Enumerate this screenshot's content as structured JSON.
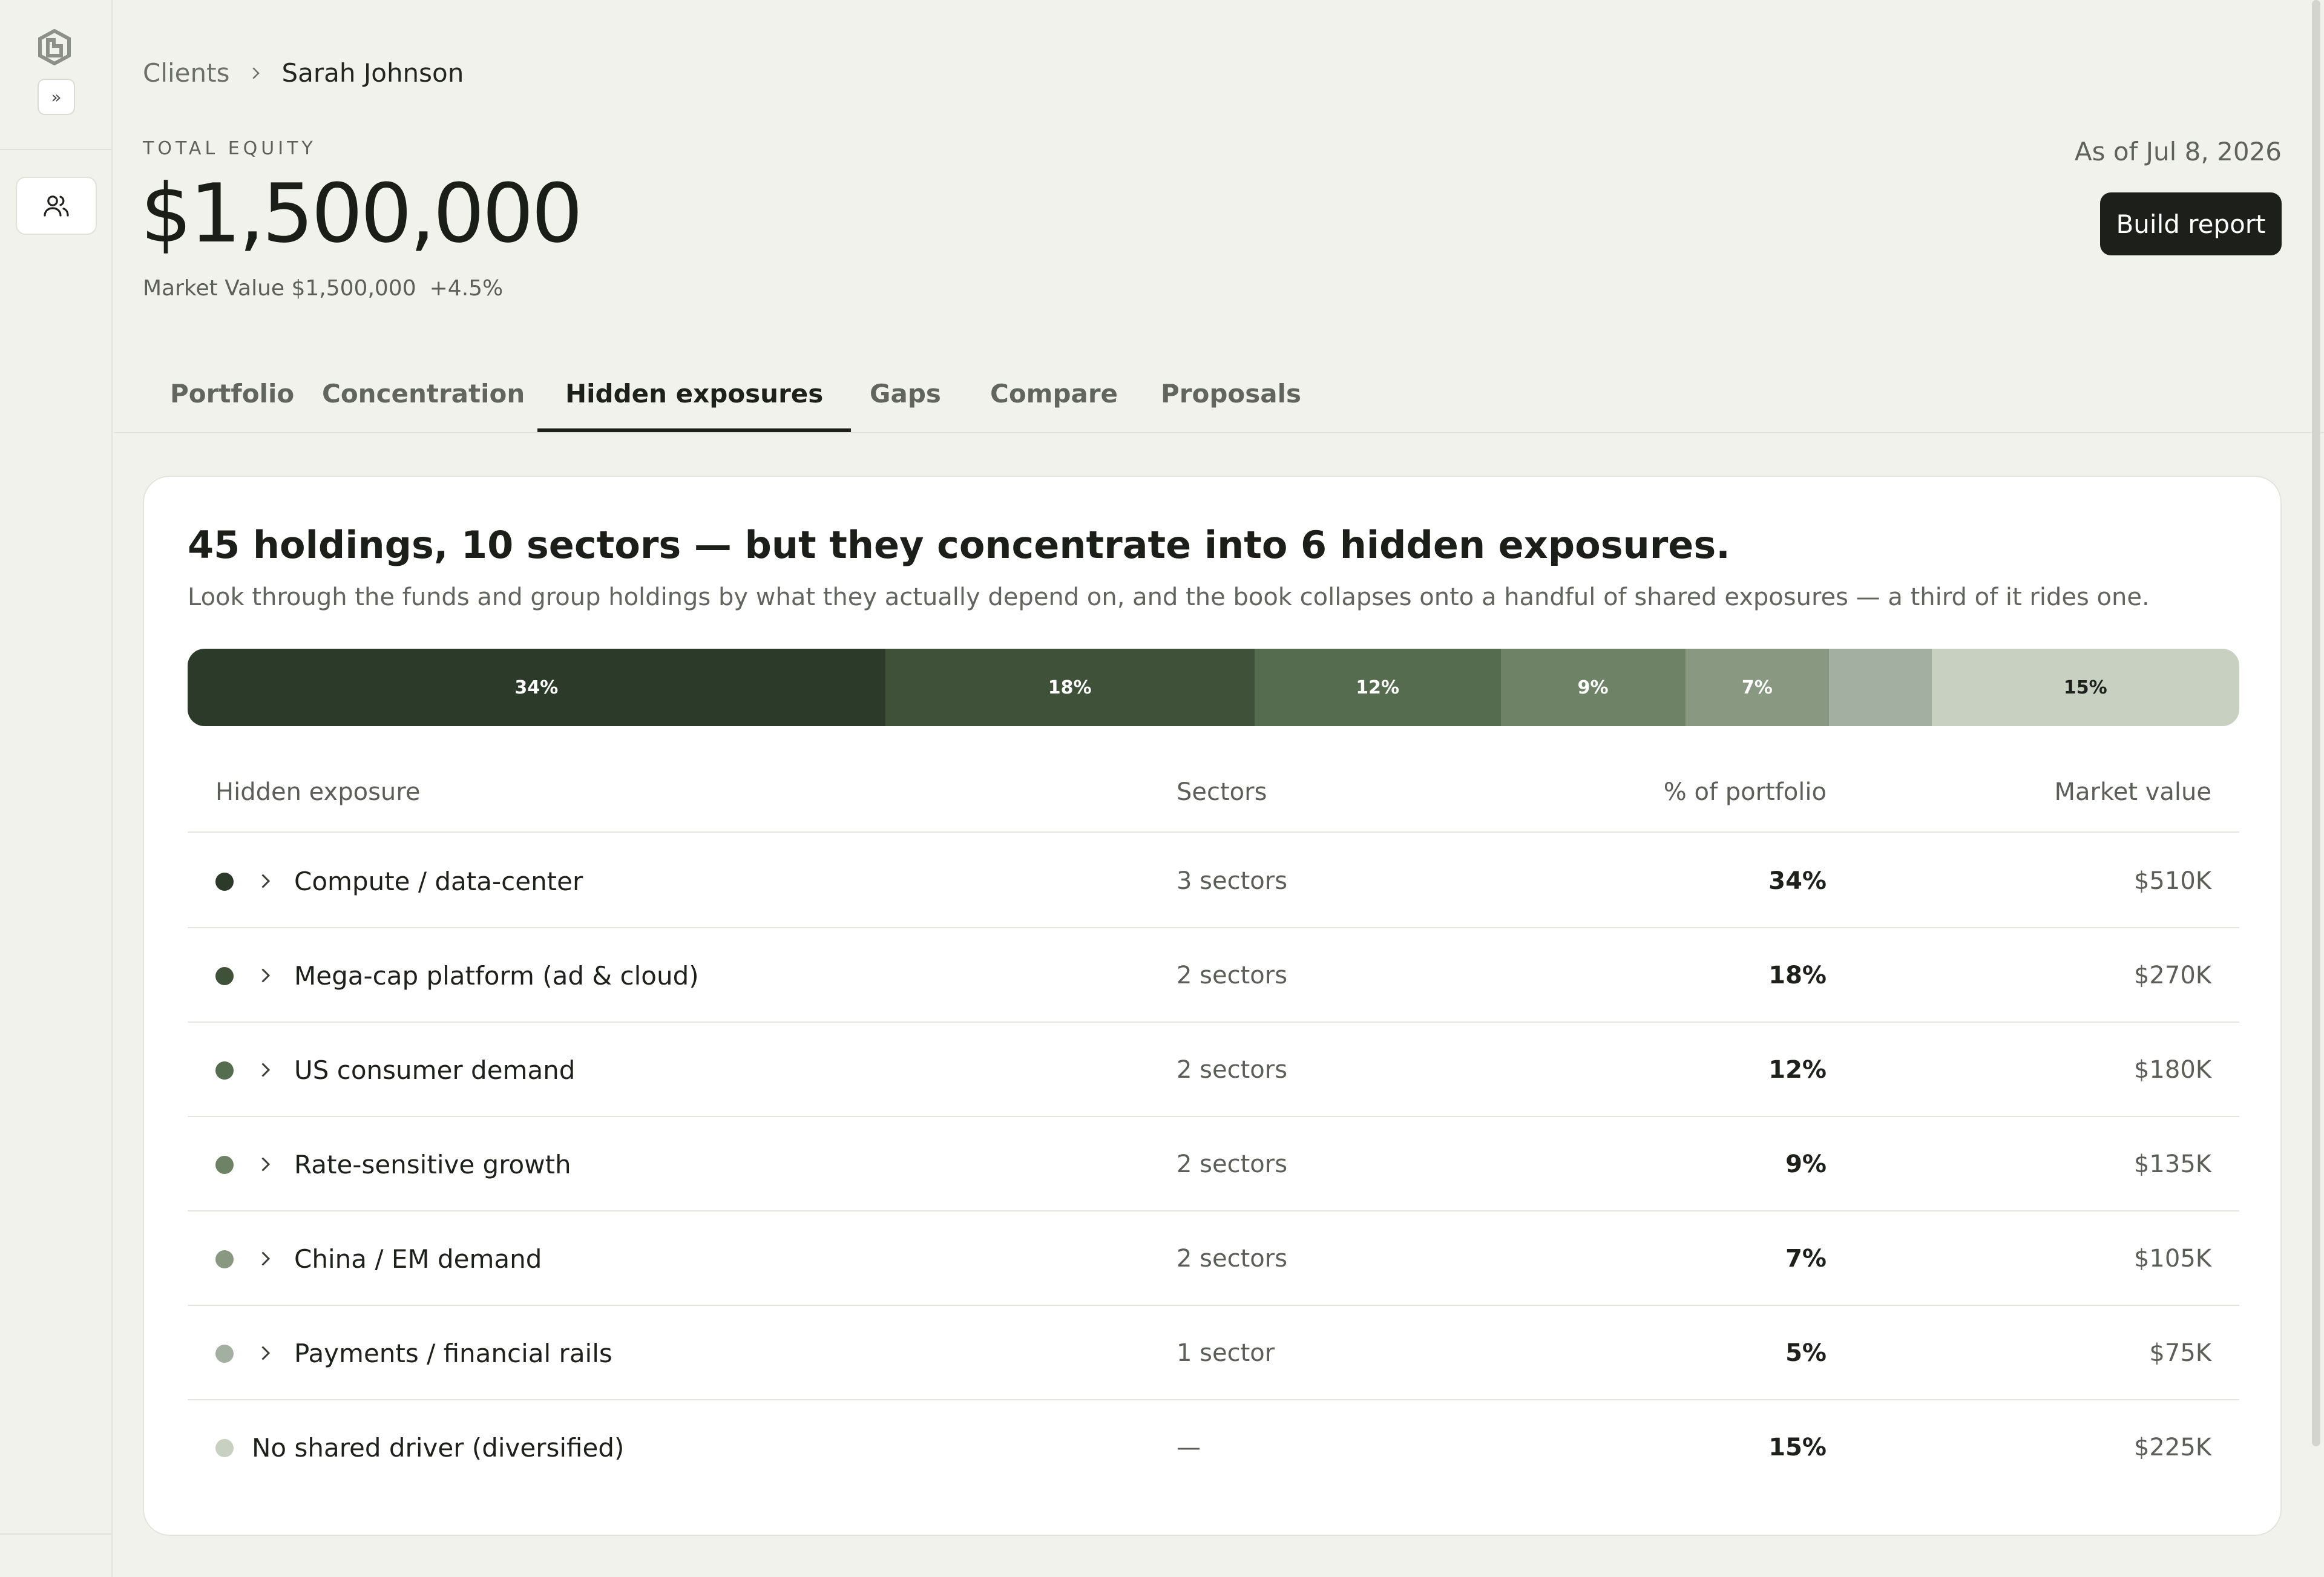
{
  "breadcrumb": {
    "parent": "Clients",
    "current": "Sarah Johnson"
  },
  "equity": {
    "label": "TOTAL EQUITY",
    "value": "$1,500,000",
    "market_value": "Market Value $1,500,000",
    "change": "+4.5%"
  },
  "as_of": "As of Jul 8, 2026",
  "build_report_label": "Build report",
  "tabs": [
    {
      "label": "Portfolio"
    },
    {
      "label": "Concentration"
    },
    {
      "label": "Hidden exposures",
      "active": true
    },
    {
      "label": "Gaps"
    },
    {
      "label": "Compare"
    },
    {
      "label": "Proposals"
    }
  ],
  "card": {
    "headline": "45 holdings, 10 sectors — but they concentrate into 6 hidden exposures.",
    "subline": "Look through the funds and group holdings by what they actually depend on, and the book collapses onto a handful of shared exposures — a third of it rides one."
  },
  "colors": {
    "compute": "#2c3a29",
    "megacap": "#3f5239",
    "consumer": "#566c4e",
    "rate": "#6e8266",
    "china": "#899981",
    "payments": "#a3afa0",
    "diversified": "#c8d0c2"
  },
  "chart_data": {
    "type": "bar",
    "orientation": "horizontal-stacked",
    "categories": [
      "Compute / data-center",
      "Mega-cap platform (ad & cloud)",
      "US consumer demand",
      "Rate-sensitive growth",
      "China / EM demand",
      "Payments / financial rails",
      "No shared driver (diversified)"
    ],
    "values": [
      34,
      18,
      12,
      9,
      7,
      5,
      15
    ],
    "data_labels": [
      "34%",
      "18%",
      "12%",
      "9%",
      "7%",
      "",
      "15%"
    ]
  },
  "table": {
    "headers": {
      "exposure": "Hidden exposure",
      "sectors": "Sectors",
      "pct": "% of portfolio",
      "mv": "Market value"
    },
    "rows": [
      {
        "name": "Compute / data-center",
        "sectors": "3 sectors",
        "pct": "34%",
        "mv": "$510K",
        "expandable": true
      },
      {
        "name": "Mega-cap platform (ad & cloud)",
        "sectors": "2 sectors",
        "pct": "18%",
        "mv": "$270K",
        "expandable": true
      },
      {
        "name": "US consumer demand",
        "sectors": "2 sectors",
        "pct": "12%",
        "mv": "$180K",
        "expandable": true
      },
      {
        "name": "Rate-sensitive growth",
        "sectors": "2 sectors",
        "pct": "9%",
        "mv": "$135K",
        "expandable": true
      },
      {
        "name": "China / EM demand",
        "sectors": "2 sectors",
        "pct": "7%",
        "mv": "$105K",
        "expandable": true
      },
      {
        "name": "Payments / financial rails",
        "sectors": "1 sector",
        "pct": "5%",
        "mv": "$75K",
        "expandable": true
      },
      {
        "name": "No shared driver (diversified)",
        "sectors": "—",
        "pct": "15%",
        "mv": "$225K",
        "expandable": false
      }
    ]
  },
  "icons": {
    "logo": "app-logo-icon",
    "expand": "double-chevron-right-icon",
    "users": "users-icon",
    "chevron": "chevron-right-icon"
  }
}
